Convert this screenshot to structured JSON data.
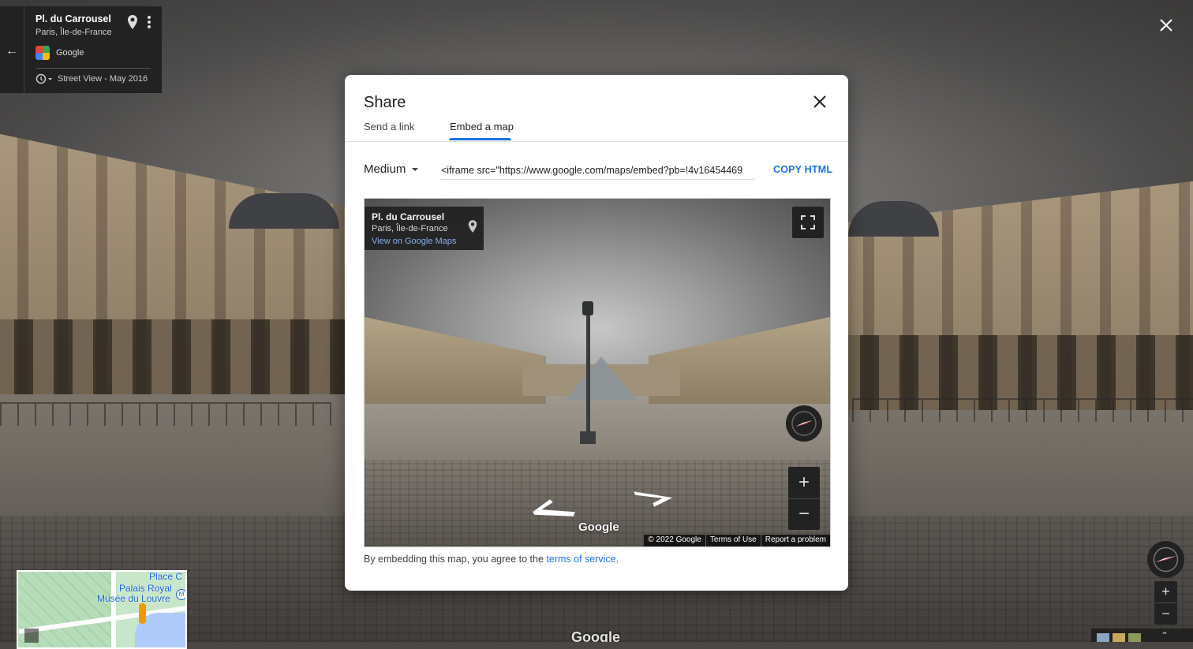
{
  "location": {
    "title": "Pl. du Carrousel",
    "subtitle": "Paris, Île-de-France",
    "provider": "Google",
    "history": "Street View - May 2016"
  },
  "dialog": {
    "title": "Share",
    "tabs": [
      {
        "label": "Send a link",
        "active": false
      },
      {
        "label": "Embed a map",
        "active": true
      }
    ],
    "size_selected": "Medium",
    "embed_code": "<iframe src=\"https://www.google.com/maps/embed?pb=!4v16454469",
    "copy_label": "COPY HTML",
    "tos_prefix": "By embedding this map, you agree to the",
    "tos_link": "terms of service",
    "tos_suffix": "."
  },
  "preview": {
    "title": "Pl. du Carrousel",
    "subtitle": "Paris, Île-de-France",
    "link": "View on Google Maps",
    "watermark": "Google",
    "footer": [
      "© 2022 Google",
      "Terms of Use",
      "Report a problem"
    ],
    "zoom_in": "+",
    "zoom_out": "−"
  },
  "minimap": {
    "labels": [
      "Place C",
      "Palais Royal",
      "Musée du Louvre"
    ],
    "metro": "M"
  },
  "controls": {
    "zoom_in": "+",
    "zoom_out": "−"
  },
  "background": {
    "watermark": "Google"
  },
  "colors": {
    "accent": "#1a73e8",
    "panel_dark": "#222222"
  },
  "icons": [
    "back-arrow-icon",
    "place-pin-icon",
    "more-vert-icon",
    "history-icon",
    "close-icon",
    "fullscreen-icon",
    "compass-icon",
    "pegman-icon"
  ]
}
